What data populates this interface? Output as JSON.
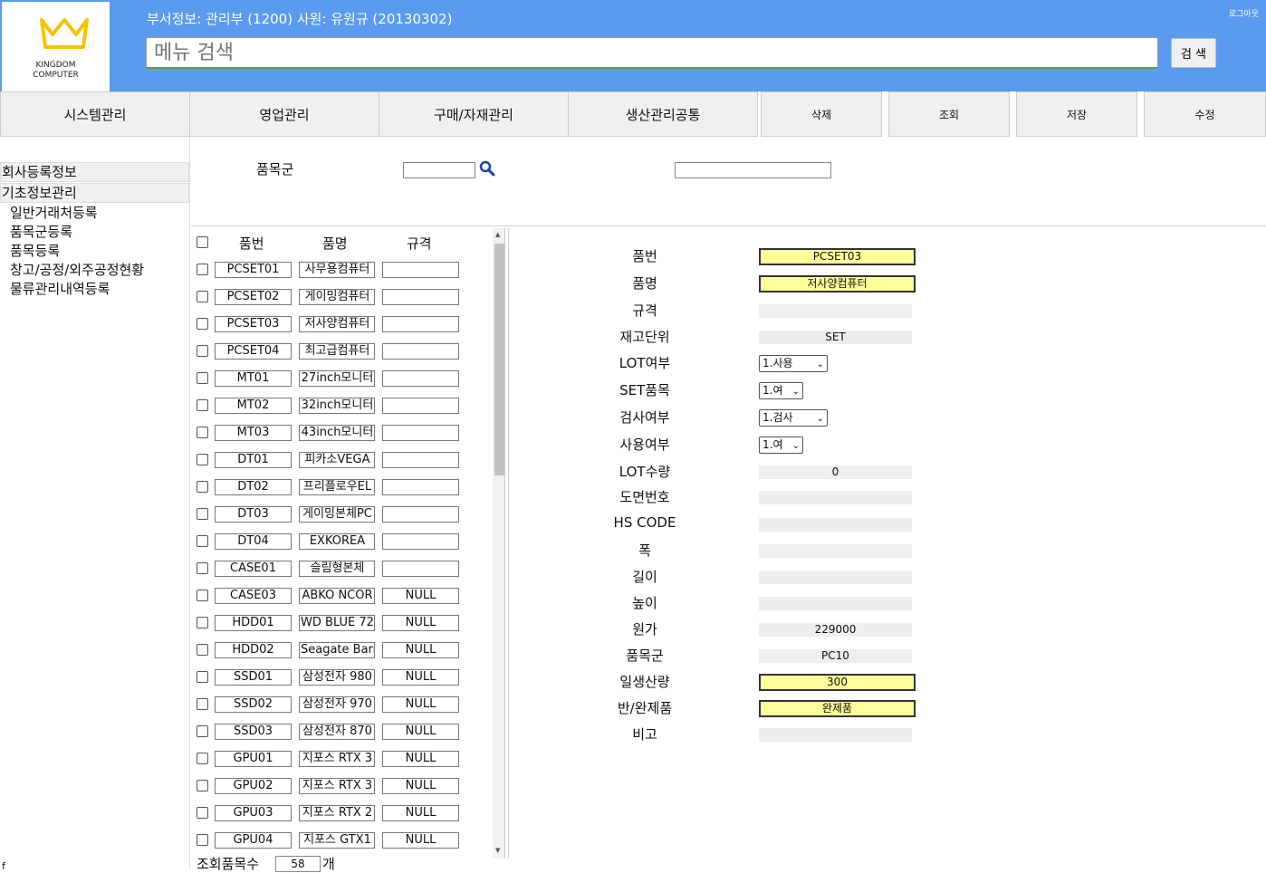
{
  "header": {
    "logo_line1": "KINGDOM",
    "logo_line2": "COMPUTER",
    "dept_info": "부서정보: 관리부 (1200) 사원: 유원규 (20130302)",
    "logout": "로그아웃",
    "search_placeholder": "메뉴 검색",
    "search_button": "검 색",
    "brand_color": "#5a9bf0"
  },
  "menu": {
    "items": [
      "시스템관리",
      "영업관리",
      "구매/자재관리",
      "생산관리공통"
    ],
    "actions": [
      "삭제",
      "조회",
      "저장",
      "수정"
    ]
  },
  "sidebar": {
    "groups": [
      "회사등록정보",
      "기초정보관리"
    ],
    "items": [
      "일반거래처등록",
      "품목군등록",
      "품목등록",
      "창고/공정/외주공정현황",
      "물류관리내역등록"
    ]
  },
  "filter": {
    "label": "품목군"
  },
  "list": {
    "headers": [
      "품번",
      "품명",
      "규격"
    ],
    "rows": [
      {
        "code": "PCSET01",
        "name": "사무용컴퓨터",
        "spec": ""
      },
      {
        "code": "PCSET02",
        "name": "게이밍컴퓨터",
        "spec": ""
      },
      {
        "code": "PCSET03",
        "name": "저사양컴퓨터",
        "spec": ""
      },
      {
        "code": "PCSET04",
        "name": "최고급컴퓨터",
        "spec": ""
      },
      {
        "code": "MT01",
        "name": "27inch모니터",
        "spec": ""
      },
      {
        "code": "MT02",
        "name": "32inch모니터",
        "spec": ""
      },
      {
        "code": "MT03",
        "name": "43inch모니터",
        "spec": ""
      },
      {
        "code": "DT01",
        "name": "피카소VEGA",
        "spec": ""
      },
      {
        "code": "DT02",
        "name": "프리플로우EL",
        "spec": ""
      },
      {
        "code": "DT03",
        "name": "게이밍본체PC",
        "spec": ""
      },
      {
        "code": "DT04",
        "name": "EXKOREA",
        "spec": ""
      },
      {
        "code": "CASE01",
        "name": "슬림형본체",
        "spec": ""
      },
      {
        "code": "CASE03",
        "name": "ABKO NCOR",
        "spec": "NULL"
      },
      {
        "code": "HDD01",
        "name": "WD BLUE 72",
        "spec": "NULL"
      },
      {
        "code": "HDD02",
        "name": "Seagate Barr",
        "spec": "NULL"
      },
      {
        "code": "SSD01",
        "name": "삼성전자 980",
        "spec": "NULL"
      },
      {
        "code": "SSD02",
        "name": "삼성전자 970",
        "spec": "NULL"
      },
      {
        "code": "SSD03",
        "name": "삼성전자 870",
        "spec": "NULL"
      },
      {
        "code": "GPU01",
        "name": "지포스 RTX 3",
        "spec": "NULL"
      },
      {
        "code": "GPU02",
        "name": "지포스 RTX 3",
        "spec": "NULL"
      },
      {
        "code": "GPU03",
        "name": "지포스 RTX 2",
        "spec": "NULL"
      },
      {
        "code": "GPU04",
        "name": "지포스 GTX1",
        "spec": "NULL"
      }
    ],
    "count_label": "조회품목수",
    "count_value": "58",
    "count_unit": "개"
  },
  "detail": {
    "fields": [
      {
        "label": "품번",
        "value": "PCSET03",
        "kind": "yellow"
      },
      {
        "label": "품명",
        "value": "저사양컴퓨터",
        "kind": "yellow"
      },
      {
        "label": "규격",
        "value": "",
        "kind": "gray"
      },
      {
        "label": "재고단위",
        "value": "SET",
        "kind": "gray"
      },
      {
        "label": "LOT여부",
        "value": "1.사용",
        "kind": "select"
      },
      {
        "label": "SET품목",
        "value": "1.여",
        "kind": "select"
      },
      {
        "label": "검사여부",
        "value": "1.검사",
        "kind": "select"
      },
      {
        "label": "사용여부",
        "value": "1.여",
        "kind": "select"
      },
      {
        "label": "LOT수량",
        "value": "0",
        "kind": "gray"
      },
      {
        "label": "도면번호",
        "value": "",
        "kind": "gray"
      },
      {
        "label": "HS CODE",
        "value": "",
        "kind": "gray"
      },
      {
        "label": "폭",
        "value": "",
        "kind": "gray"
      },
      {
        "label": "길이",
        "value": "",
        "kind": "gray"
      },
      {
        "label": "높이",
        "value": "",
        "kind": "gray"
      },
      {
        "label": "원가",
        "value": "229000",
        "kind": "gray"
      },
      {
        "label": "품목군",
        "value": "PC10",
        "kind": "gray"
      },
      {
        "label": "일생산량",
        "value": "300",
        "kind": "yellow"
      },
      {
        "label": "반/완제품",
        "value": "완제품",
        "kind": "yellow"
      },
      {
        "label": "비고",
        "value": "",
        "kind": "gray"
      }
    ]
  },
  "footer": {
    "char": "f"
  }
}
